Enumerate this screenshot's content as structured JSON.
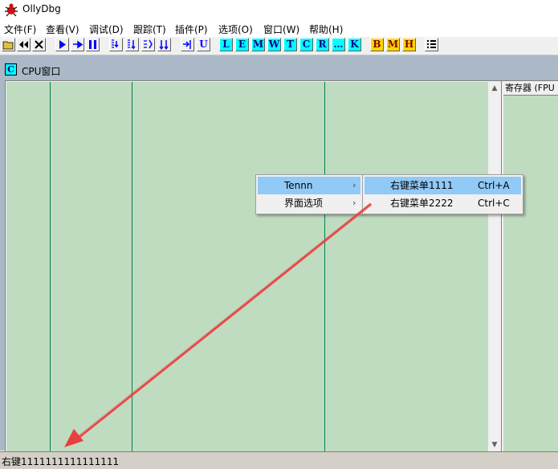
{
  "window": {
    "title": "OllyDbg",
    "app_icon": "bug-icon"
  },
  "menubar": {
    "items": [
      {
        "label": "文件(F)"
      },
      {
        "label": "查看(V)"
      },
      {
        "label": "调试(D)"
      },
      {
        "label": "跟踪(T)"
      },
      {
        "label": "插件(P)"
      },
      {
        "label": "选项(O)"
      },
      {
        "label": "窗口(W)"
      },
      {
        "label": "帮助(H)"
      }
    ]
  },
  "toolbar": {
    "open_icon": "folder-open-icon",
    "restart_icon": "rewind-icon",
    "close_icon": "close-icon",
    "run_icon": "play-icon",
    "step_icon": "step-icon",
    "pause_icon": "pause-icon",
    "letters": [
      "L",
      "E",
      "M",
      "W",
      "T",
      "C",
      "R",
      "…",
      "K"
    ],
    "highlight_letters": [
      "B",
      "M",
      "H"
    ],
    "list_icon": "list-icon",
    "u_label": "U"
  },
  "cpu_window": {
    "icon_letter": "C",
    "title": "CPU窗口",
    "register_header": "寄存器 (FPU"
  },
  "context_menu": {
    "items": [
      {
        "label": "Tennn",
        "submenu": "›",
        "highlighted": true
      },
      {
        "label": "界面选项",
        "submenu": "›",
        "highlighted": false
      }
    ]
  },
  "submenu": {
    "items": [
      {
        "label": "右键菜单1111",
        "shortcut": "Ctrl+A",
        "highlighted": true
      },
      {
        "label": "右键菜单2222",
        "shortcut": "Ctrl+C",
        "highlighted": false
      }
    ]
  },
  "status_bar": {
    "text": "右键1111111111111111"
  },
  "colors": {
    "dump_bg": "#c0dcc0",
    "highlight": "#91c9f7",
    "arrow": "#e84040",
    "column_line": "#008050"
  }
}
